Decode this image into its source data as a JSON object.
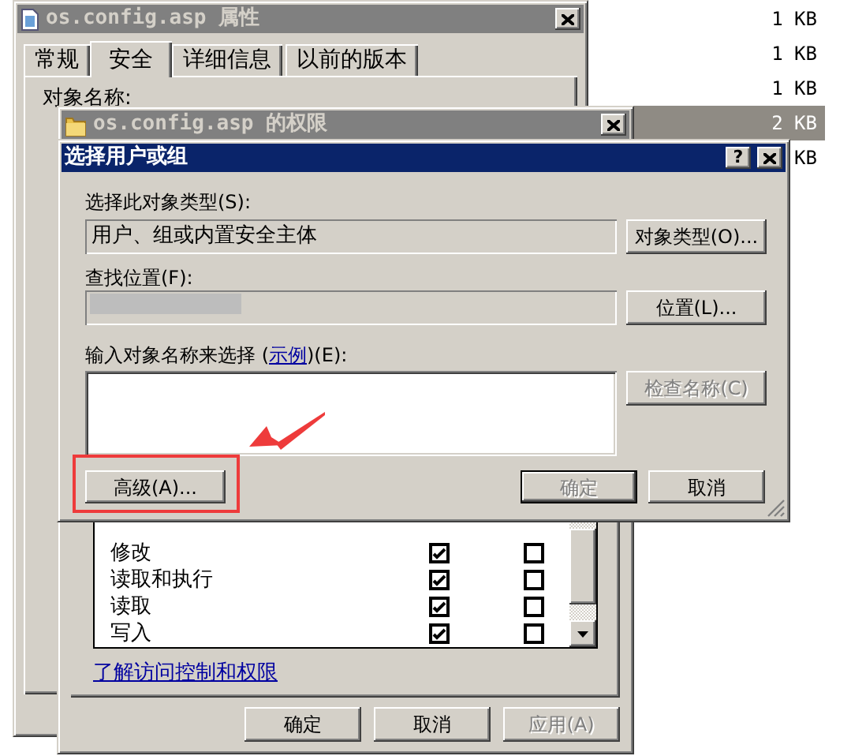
{
  "file_list": {
    "rows": [
      {
        "size": "1 KB",
        "selected": false
      },
      {
        "size": "1 KB",
        "selected": false
      },
      {
        "size": "1 KB",
        "selected": false
      },
      {
        "size": "2 KB",
        "selected": true
      },
      {
        "size": "KB",
        "selected": false
      }
    ]
  },
  "properties_window": {
    "title": "os.config.asp 属性",
    "tabs": [
      {
        "label": "常规",
        "selected": false
      },
      {
        "label": "安全",
        "selected": true
      },
      {
        "label": "详细信息",
        "selected": false
      },
      {
        "label": "以前的版本",
        "selected": false
      }
    ],
    "object_name_label": "对象名称:"
  },
  "permissions_window": {
    "title": "os.config.asp 的权限",
    "permissions": [
      {
        "name": "修改",
        "allow": true,
        "deny": false
      },
      {
        "name": "读取和执行",
        "allow": true,
        "deny": false
      },
      {
        "name": "读取",
        "allow": true,
        "deny": false
      },
      {
        "name": "写入",
        "allow": true,
        "deny": false
      }
    ],
    "link": "了解访问控制和权限",
    "buttons": [
      {
        "label": "确定",
        "disabled": false
      },
      {
        "label": "取消",
        "disabled": false
      },
      {
        "label": "应用(A)",
        "disabled": true
      }
    ]
  },
  "select_dialog": {
    "title": "选择用户或组",
    "help_button": "?",
    "object_types_label": "选择此对象类型(S):",
    "object_types_value": "用户、组或内置安全主体",
    "object_types_button": {
      "label": "对象类型(O)...",
      "disabled": false
    },
    "location_label": "查找位置(F):",
    "location_button": {
      "label": "位置(L)...",
      "disabled": false
    },
    "names_label_before": "输入对象名称来选择 (",
    "names_label_link": "示例",
    "names_label_after": ")(E):",
    "check_names_button": {
      "label": "检查名称(C)",
      "disabled": true
    },
    "advanced_button": {
      "label": "高级(A)...",
      "highlighted": true
    },
    "ok_button": {
      "label": "确定",
      "disabled": true
    },
    "cancel_button": {
      "label": "取消",
      "disabled": false
    }
  }
}
